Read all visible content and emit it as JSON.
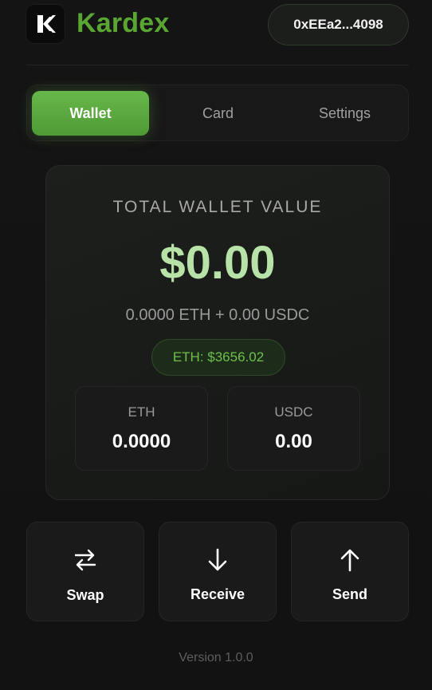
{
  "header": {
    "brand": "Kardex",
    "address": "0xEEa2...4098",
    "logo_icon": "k-logo-icon"
  },
  "tabs": [
    {
      "label": "Wallet",
      "active": true
    },
    {
      "label": "Card",
      "active": false
    },
    {
      "label": "Settings",
      "active": false
    }
  ],
  "balance": {
    "label": "TOTAL WALLET VALUE",
    "value": "$0.00",
    "breakdown": "0.0000 ETH + 0.00 USDC",
    "eth_price": "ETH: $3656.02"
  },
  "tokens": [
    {
      "name": "ETH",
      "amount": "0.0000"
    },
    {
      "name": "USDC",
      "amount": "0.00"
    }
  ],
  "actions": [
    {
      "label": "Swap",
      "icon": "swap-icon"
    },
    {
      "label": "Receive",
      "icon": "arrow-down-icon"
    },
    {
      "label": "Send",
      "icon": "arrow-up-icon"
    }
  ],
  "footer": {
    "version": "Version 1.0.0"
  },
  "colors": {
    "accent": "#5aa632",
    "balance_text": "#b8e3a8",
    "background": "#121212"
  }
}
